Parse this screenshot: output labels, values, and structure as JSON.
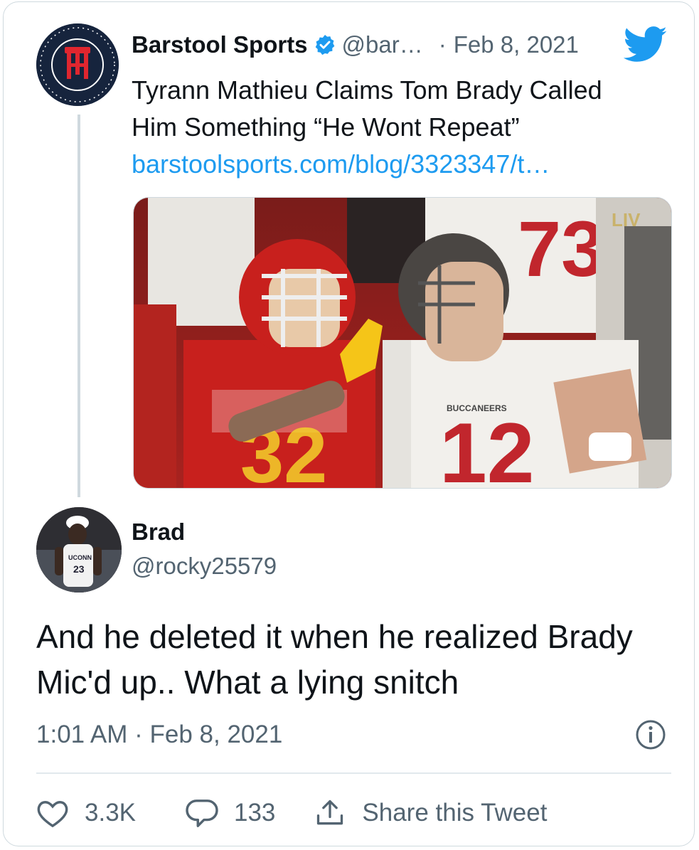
{
  "quoted_tweet": {
    "author_name": "Barstool Sports",
    "handle": "@bar…",
    "separator": "·",
    "date": "Feb 8, 2021",
    "text_line1": "Tyrann Mathieu Claims Tom Brady Called",
    "text_line2": "Him Something “He Wont Repeat”",
    "link": "barstoolsports.com/blog/3323347/t…",
    "avatar_icon": "barstool-logo-icon",
    "media": {
      "jersey_left": "32",
      "jersey_right": "12",
      "jersey_back": "73",
      "event_logo": "LIV",
      "team_label": "BUCCANEERS"
    }
  },
  "reply_tweet": {
    "author_name": "Brad",
    "handle": "@rocky25579",
    "text_line1": "And he deleted it when he realized Brady",
    "text_line2": "Mic'd up.. What a lying snitch",
    "timestamp": "1:01 AM · Feb 8, 2021",
    "avatar_jersey_text": "UCONN",
    "avatar_jersey_number": "23"
  },
  "actions": {
    "likes": "3.3K",
    "replies": "133",
    "share_label": "Share this Tweet"
  },
  "colors": {
    "primary_text": "#0f1419",
    "secondary_text": "#536471",
    "link": "#1d9bf0",
    "verified": "#1d9bf0",
    "twitter_bird": "#1d9bf0",
    "border": "#cfd9de"
  }
}
